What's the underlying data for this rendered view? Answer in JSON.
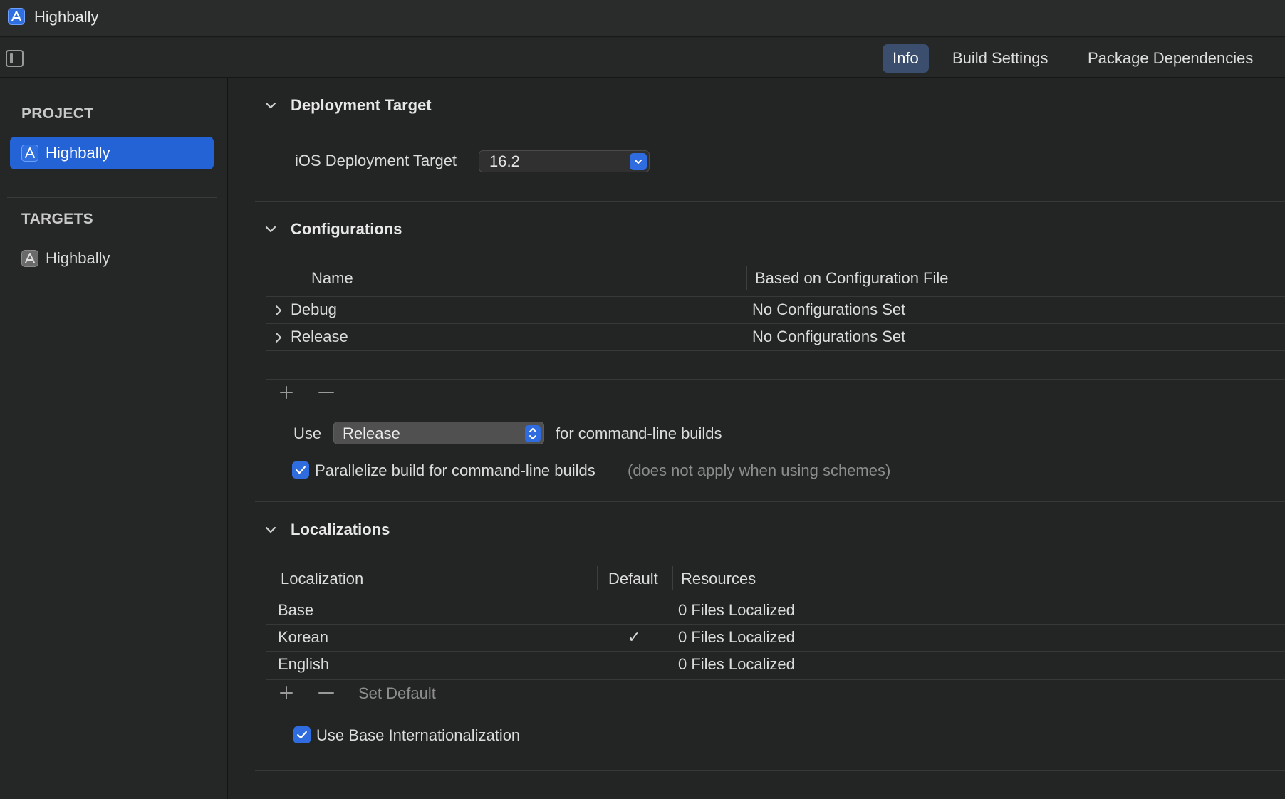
{
  "window": {
    "title": "Highbally"
  },
  "toolbar": {
    "tabs": [
      {
        "label": "Info",
        "active": true
      },
      {
        "label": "Build Settings",
        "active": false
      },
      {
        "label": "Package Dependencies",
        "active": false
      }
    ]
  },
  "sidebar": {
    "project_heading": "PROJECT",
    "project_item": "Highbally",
    "targets_heading": "TARGETS",
    "target_item": "Highbally"
  },
  "deployment": {
    "title": "Deployment Target",
    "label": "iOS Deployment Target",
    "value": "16.2"
  },
  "configurations": {
    "title": "Configurations",
    "columns": {
      "name": "Name",
      "file": "Based on Configuration File"
    },
    "rows": [
      {
        "name": "Debug",
        "file": "No Configurations Set"
      },
      {
        "name": "Release",
        "file": "No Configurations Set"
      }
    ],
    "use_label": "Use",
    "use_value": "Release",
    "use_suffix": "for command-line builds",
    "parallelize_label": "Parallelize build for command-line builds",
    "parallelize_note": "(does not apply when using schemes)",
    "parallelize_checked": true
  },
  "localizations": {
    "title": "Localizations",
    "columns": {
      "localization": "Localization",
      "default": "Default",
      "resources": "Resources"
    },
    "rows": [
      {
        "name": "Base",
        "default": "",
        "resources": "0 Files Localized"
      },
      {
        "name": "Korean",
        "default": "✓",
        "resources": "0 Files Localized"
      },
      {
        "name": "English",
        "default": "",
        "resources": "0 Files Localized"
      }
    ],
    "set_default": "Set Default",
    "base_intl_label": "Use Base Internationalization",
    "base_intl_checked": true
  },
  "colors": {
    "accent": "#2e6cdf",
    "selection": "#2463d6",
    "active_tab": "#3b4e6d"
  }
}
